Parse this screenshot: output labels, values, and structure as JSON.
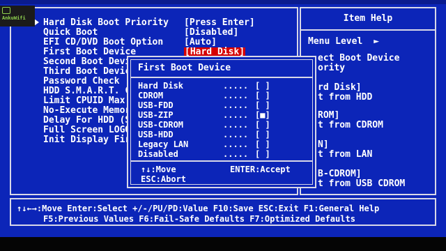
{
  "logo": {
    "text": "AnkuWifi"
  },
  "settings": [
    {
      "label": "Hard Disk Boot Priority",
      "value": "[Press Enter]"
    },
    {
      "label": "Quick Boot",
      "value": "[Disabled]"
    },
    {
      "label": "EFI CD/DVD Boot Option",
      "value": "[Auto]"
    },
    {
      "label": "First Boot Device",
      "value": "[Hard Disk]"
    },
    {
      "label": "Second Boot Devic",
      "value": ""
    },
    {
      "label": "Third Boot Device",
      "value": ""
    },
    {
      "label": "Password Check",
      "value": ""
    },
    {
      "label": "HDD S.M.A.R.T. Ca",
      "value": ""
    },
    {
      "label": "Limit CPUID Max.",
      "value": ""
    },
    {
      "label": "No-Execute Memory",
      "value": ""
    },
    {
      "label": "Delay For HDD (Se",
      "value": ""
    },
    {
      "label": "Full Screen LOGO",
      "value": ""
    },
    {
      "label": "Init Display Firs",
      "value": ""
    }
  ],
  "help": {
    "title": "Item Help",
    "menu_level": "Menu Level",
    "menu_arrow": "►",
    "lines": [
      "ect Boot Device",
      "ority",
      "rd Disk]",
      "t from HDD",
      "ROM]",
      "t from CDROM",
      "N]",
      "t from LAN",
      "B-CDROM]",
      "t from USB CDROM"
    ]
  },
  "popup": {
    "title": "First Boot Device",
    "options": [
      {
        "label": "Hard Disk",
        "dots": ".....",
        "box": "[ ]"
      },
      {
        "label": "CDROM",
        "dots": ".....",
        "box": "[ ]"
      },
      {
        "label": "USB-FDD",
        "dots": ".....",
        "box": "[ ]"
      },
      {
        "label": "USB-ZIP",
        "dots": ".....",
        "box": "[■]"
      },
      {
        "label": "USB-CDROM",
        "dots": ".....",
        "box": "[ ]"
      },
      {
        "label": "USB-HDD",
        "dots": ".....",
        "box": "[ ]"
      },
      {
        "label": "Legacy LAN",
        "dots": ".....",
        "box": "[ ]"
      },
      {
        "label": "Disabled",
        "dots": ".....",
        "box": "[ ]"
      }
    ],
    "move": "↑↓:Move",
    "accept": "ENTER:Accept",
    "abort": "ESC:Abort"
  },
  "footer": {
    "line1": "↑↓←→:Move  Enter:Select  +/-/PU/PD:Value  F10:Save  ESC:Exit  F1:General Help",
    "line2": "F5:Previous Values  F6:Fail-Safe Defaults  F7:Optimized Defaults"
  }
}
